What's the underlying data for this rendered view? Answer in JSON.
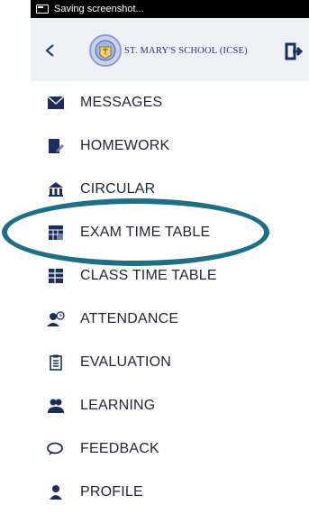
{
  "status_bar": {
    "text": "Saving screenshot..."
  },
  "header": {
    "school_name": "ST. MARY'S SCHOOL (ICSE)"
  },
  "menu": {
    "items": [
      {
        "label": "MESSAGES",
        "icon": "envelope-icon"
      },
      {
        "label": "HOMEWORK",
        "icon": "homework-icon"
      },
      {
        "label": "CIRCULAR",
        "icon": "circular-icon"
      },
      {
        "label": "EXAM TIME TABLE",
        "icon": "exam-timetable-icon"
      },
      {
        "label": "CLASS TIME TABLE",
        "icon": "class-timetable-icon"
      },
      {
        "label": "ATTENDANCE",
        "icon": "attendance-icon"
      },
      {
        "label": "EVALUATION",
        "icon": "evaluation-icon"
      },
      {
        "label": "LEARNING",
        "icon": "learning-icon"
      },
      {
        "label": "FEEDBACK",
        "icon": "feedback-icon"
      },
      {
        "label": "PROFILE",
        "icon": "profile-icon"
      }
    ]
  },
  "colors": {
    "icon": "#1e2e5c",
    "highlight": "#1e6f86"
  }
}
